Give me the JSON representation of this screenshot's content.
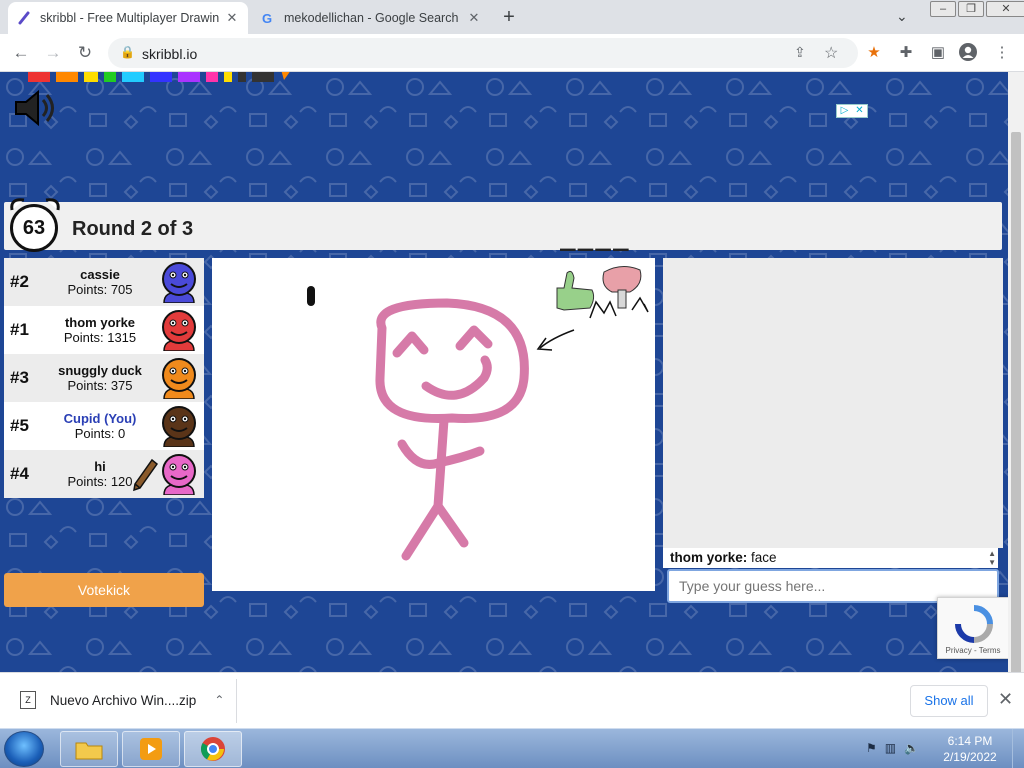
{
  "browser": {
    "tabs": [
      {
        "title": "skribbl - Free Multiplayer Drawin",
        "active": true
      },
      {
        "title": "mekodellichan - Google Search",
        "active": false
      }
    ],
    "url": "skribbl.io"
  },
  "game": {
    "timer": "63",
    "round_text": "Round 2 of 3",
    "word_hint": "____",
    "players": [
      {
        "rank": "#2",
        "name": "cassie",
        "points": "Points: 705",
        "avatar_color": "#4a4ad9",
        "is_me": false,
        "drawing": false
      },
      {
        "rank": "#1",
        "name": "thom yorke",
        "points": "Points: 1315",
        "avatar_color": "#e23b3b",
        "is_me": false,
        "drawing": false
      },
      {
        "rank": "#3",
        "name": "snuggly duck",
        "points": "Points: 375",
        "avatar_color": "#f08a1c",
        "is_me": false,
        "drawing": false
      },
      {
        "rank": "#5",
        "name": "Cupid (You)",
        "points": "Points: 0",
        "avatar_color": "#5a3418",
        "is_me": true,
        "drawing": false
      },
      {
        "rank": "#4",
        "name": "hi",
        "points": "Points: 120",
        "avatar_color": "#e868c8",
        "is_me": false,
        "drawing": true
      }
    ],
    "votekick_label": "Votekick",
    "chat": {
      "messages": [
        {
          "author": "thom yorke:",
          "text": " face"
        }
      ],
      "input_placeholder": "Type your guess here..."
    },
    "drawing_color": "#d67aa8"
  },
  "ad": {
    "choice_labels": [
      "▷",
      "✕"
    ]
  },
  "recaptcha": {
    "terms": "Privacy - Terms"
  },
  "downloads": {
    "item": "Nuevo Archivo Win....zip",
    "show_all": "Show all"
  },
  "taskbar": {
    "time": "6:14 PM",
    "date": "2/19/2022"
  },
  "colors": {
    "page_bg": "#1e4695",
    "votekick": "#f0a24a",
    "me_name": "#2a3fb5"
  }
}
